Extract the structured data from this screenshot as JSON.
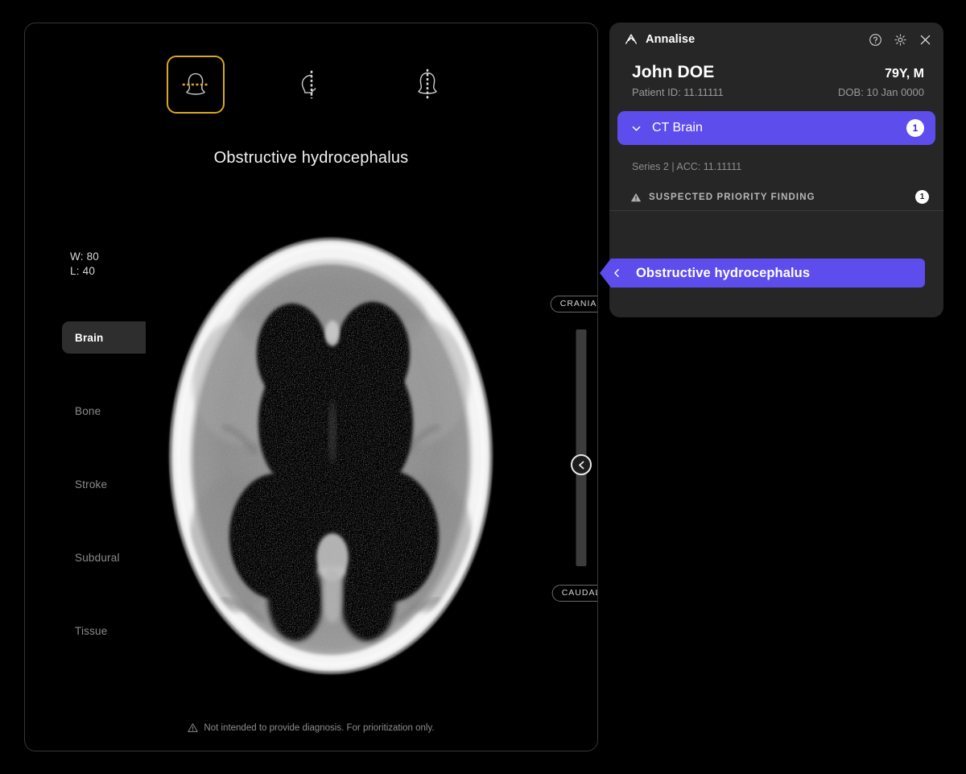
{
  "viewer": {
    "planes": [
      {
        "name": "axial",
        "label": "Axial",
        "selected": true
      },
      {
        "name": "sagittal",
        "label": "Sagittal",
        "selected": false
      },
      {
        "name": "coronal",
        "label": "Coronal",
        "selected": false
      }
    ],
    "finding_title": "Obstructive hydrocephalus",
    "window": {
      "width_label": "W: 80",
      "level_label": "L: 40"
    },
    "presets": [
      {
        "label": "Brain",
        "active": true
      },
      {
        "label": "Bone",
        "active": false
      },
      {
        "label": "Stroke",
        "active": false
      },
      {
        "label": "Subdural",
        "active": false
      },
      {
        "label": "Tissue",
        "active": false
      }
    ],
    "slider": {
      "top_label": "CRANIAL",
      "bottom_label": "CAUDAL",
      "handle_icon": "chevron-left-icon"
    },
    "disclaimer": "Not intended to provide diagnosis. For prioritization only."
  },
  "panel": {
    "brand": {
      "name": "Annalise",
      "logo_icon": "annalise-triangle-logo"
    },
    "actions": [
      {
        "name": "help-icon",
        "label": "Help"
      },
      {
        "name": "settings-gear-icon",
        "label": "Settings"
      },
      {
        "name": "close-icon",
        "label": "Close"
      }
    ],
    "patient": {
      "name": "John DOE",
      "age_sex": "79Y, M",
      "patient_id": "Patient ID: 11.11111",
      "dob": "DOB: 10 Jan 0000"
    },
    "study": {
      "label": "CT Brain",
      "count": "1",
      "expanded": true,
      "chevron_icon": "chevron-down-icon"
    },
    "series_info": "Series 2 | ACC: 11.11111",
    "priority_section": {
      "label": "SUSPECTED PRIORITY FINDING",
      "count": "1",
      "icon": "warning-triangle-icon"
    },
    "findings": [
      {
        "label": "Obstructive hydrocephalus",
        "selected": true,
        "chevron_icon": "chevron-left-icon"
      }
    ]
  },
  "colors": {
    "accent_purple": "#5d4ded",
    "selected_gold": "#d8a81f",
    "panel_bg": "#262626",
    "page_bg": "#000000"
  }
}
